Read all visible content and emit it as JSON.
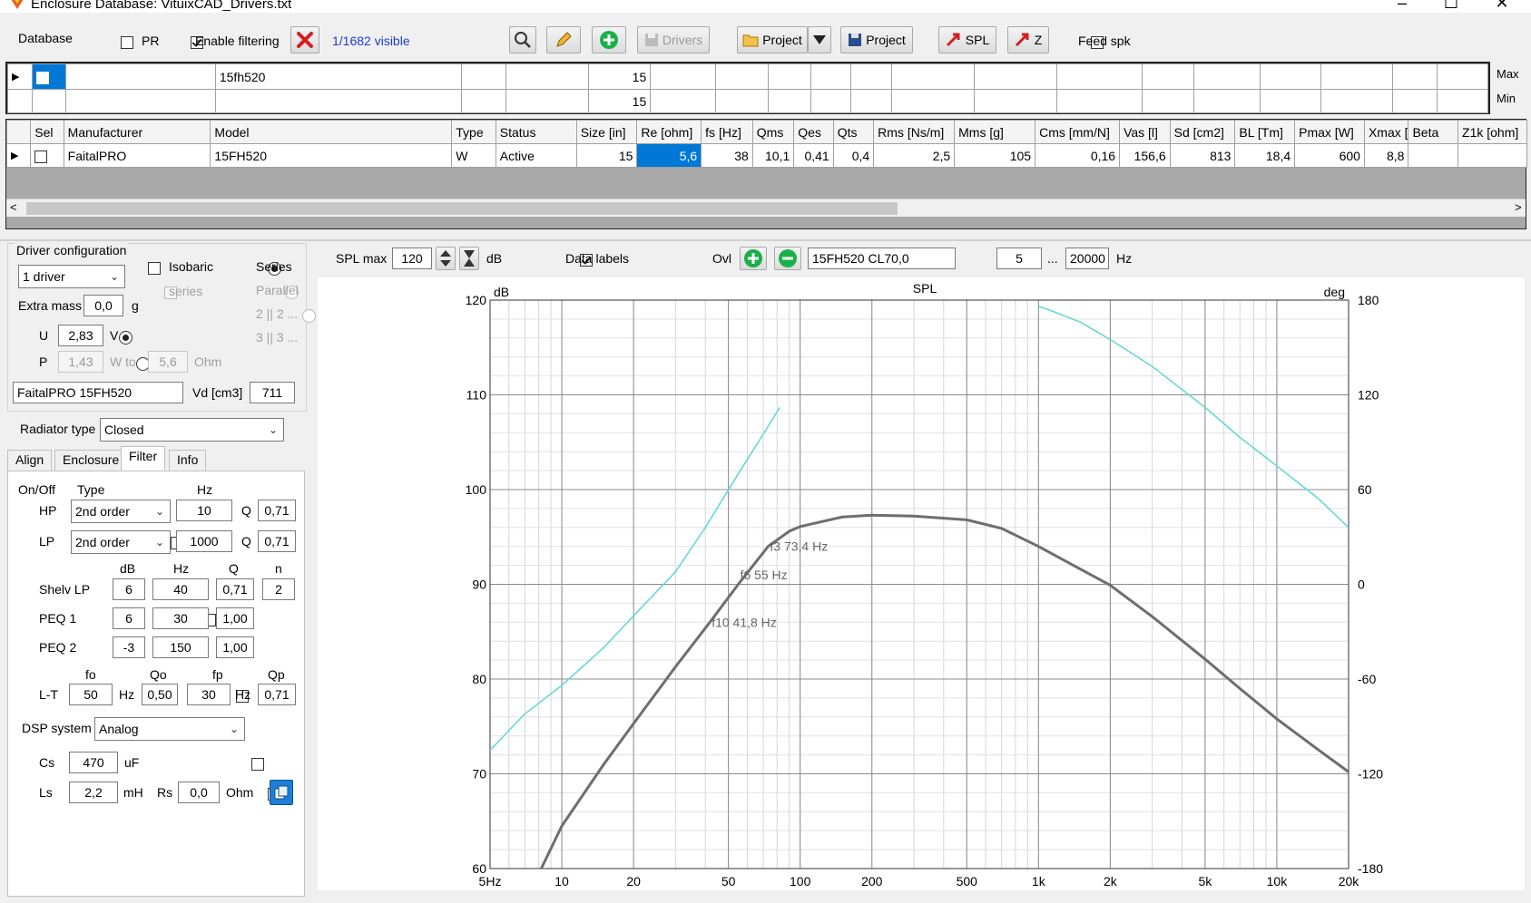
{
  "window": {
    "title": "Enclosure  Database: VituixCAD_Drivers.txt",
    "controls": [
      "–",
      "☐",
      "✕"
    ]
  },
  "toolbar": {
    "database_label": "Database",
    "pr_label": "PR",
    "pr_checked": false,
    "filtering_label": "Enable filtering",
    "filtering_checked": true,
    "visible_count": "1/1682 visible",
    "drivers_label": "Drivers",
    "project_open_label": "Project",
    "project_save_label": "Project",
    "spl_label": "SPL",
    "z_label": "Z",
    "feed_spk_label": "Feed spk",
    "feed_spk_checked": false
  },
  "filter_grid": {
    "model_filter": "15fh520",
    "size_max": "15",
    "size_min": "15",
    "max_label": "Max",
    "min_label": "Min"
  },
  "driver_table": {
    "columns": [
      "Sel",
      "Manufacturer",
      "Model",
      "Type",
      "Status",
      "Size [in]",
      "Re [ohm]",
      "fs [Hz]",
      "Qms",
      "Qes",
      "Qts",
      "Rms [Ns/m]",
      "Mms [g]",
      "Cms [mm/N]",
      "Vas [l]",
      "Sd [cm2]",
      "BL [Tm]",
      "Pmax [W]",
      "Xmax [mm]",
      "Beta",
      "Z1k [ohm]"
    ],
    "rows": [
      {
        "cells": [
          "",
          "FaitalPRO",
          "15FH520",
          "W",
          "Active",
          "15",
          "5,6",
          "38",
          "10,1",
          "0,41",
          "0,4",
          "2,5",
          "105",
          "0,16",
          "156,6",
          "813",
          "18,4",
          "600",
          "8,8",
          "",
          ""
        ]
      }
    ]
  },
  "driver_config": {
    "group_label": "Driver configuration",
    "drivers_select": "1 driver",
    "isobaric_label": "Isobaric",
    "series_sub_label": "series",
    "series_label": "Series",
    "parallel_label": "Parallel",
    "two_label": "2 || 2 ...",
    "three_label": "3 || 3 ...",
    "extra_mass_label": "Extra mass",
    "extra_mass_value": "0,0",
    "extra_mass_unit": "g",
    "u_label": "U",
    "u_value": "2,83",
    "u_unit": "V",
    "p_label": "P",
    "p_value": "1,43",
    "p_unit": "W to",
    "ohm_value": "5,6",
    "ohm_unit": "Ohm",
    "driver_name": "FaitalPRO 15FH520",
    "vd_label": "Vd [cm3]",
    "vd_value": "711",
    "radiator_label": "Radiator type",
    "radiator_value": "Closed"
  },
  "tabs": [
    "Align",
    "Enclosure",
    "Filter",
    "Info"
  ],
  "filter_tab": {
    "onoff_label": "On/Off",
    "type_label": "Type",
    "hz_label": "Hz",
    "hp_label": "HP",
    "hp_type": "2nd order",
    "hp_hz": "10",
    "q_label": "Q",
    "hp_q": "0,71",
    "lp_label": "LP",
    "lp_type": "2nd order",
    "lp_hz": "1000",
    "lp_q": "0,71",
    "db_col": "dB",
    "hz_col": "Hz",
    "q_col": "Q",
    "n_col": "n",
    "shelv_label": "Shelv LP",
    "shelv_db": "6",
    "shelv_hz": "40",
    "shelv_q": "0,71",
    "shelv_n": "2",
    "peq1_label": "PEQ 1",
    "peq1_db": "6",
    "peq1_hz": "30",
    "peq1_q": "1,00",
    "peq2_label": "PEQ 2",
    "peq2_db": "-3",
    "peq2_hz": "150",
    "peq2_q": "1,00",
    "fo_label": "fo",
    "qo_label": "Qo",
    "fp_label": "fp",
    "qp_label": "Qp",
    "lt_label": "L-T",
    "lt_fo": "50",
    "lt_qo": "0,50",
    "lt_fp": "30",
    "lt_qp": "0,71",
    "lt_hz1": "Hz",
    "lt_hz2": "Hz",
    "dsp_label": "DSP system",
    "dsp_value": "Analog",
    "cs_label": "Cs",
    "cs_value": "470",
    "cs_unit": "uF",
    "ls_label": "Ls",
    "ls_value": "2,2",
    "ls_unit": "mH",
    "rs_label": "Rs",
    "rs_value": "0,0",
    "rs_unit": "Ohm"
  },
  "chart_bar": {
    "splmax_label": "SPL max",
    "splmax_checked": true,
    "splmax_value": "120",
    "db_unit": "dB",
    "datalabels_label": "Data labels",
    "datalabels_checked": true,
    "ovl_label": "Ovl",
    "overlay_name": "15FH520 CL70,0",
    "freq_min": "5",
    "dots": "...",
    "freq_max": "20000",
    "hz_unit": "Hz"
  },
  "chart_data": {
    "type": "line",
    "title": "SPL",
    "ylabel_left": "dB",
    "ylabel_right": "deg",
    "x_scale": "log",
    "xlim": [
      5,
      20000
    ],
    "ylim": [
      60,
      120
    ],
    "y2lim": [
      -180,
      180
    ],
    "x_ticks": [
      {
        "v": 5,
        "label": "5Hz"
      },
      {
        "v": 10,
        "label": "10"
      },
      {
        "v": 20,
        "label": "20"
      },
      {
        "v": 50,
        "label": "50"
      },
      {
        "v": 100,
        "label": "100"
      },
      {
        "v": 200,
        "label": "200"
      },
      {
        "v": 500,
        "label": "500"
      },
      {
        "v": 1000,
        "label": "1k"
      },
      {
        "v": 2000,
        "label": "2k"
      },
      {
        "v": 5000,
        "label": "5k"
      },
      {
        "v": 10000,
        "label": "10k"
      },
      {
        "v": 20000,
        "label": "20k"
      }
    ],
    "y_ticks": [
      60,
      70,
      80,
      90,
      100,
      110,
      120
    ],
    "y2_ticks": [
      -180,
      -120,
      -60,
      0,
      60,
      120,
      180
    ],
    "grid": true,
    "series": [
      {
        "axis": "left",
        "color": "#6e6e6e",
        "points": [
          [
            8.2,
            60
          ],
          [
            10,
            64.5
          ],
          [
            15,
            71.0
          ],
          [
            20,
            75.3
          ],
          [
            30,
            81.3
          ],
          [
            41.8,
            86.0
          ],
          [
            55,
            90.0
          ],
          [
            73.4,
            94.0
          ],
          [
            90,
            95.6
          ],
          [
            100,
            96.1
          ],
          [
            150,
            97.1
          ],
          [
            200,
            97.3
          ],
          [
            300,
            97.2
          ],
          [
            500,
            96.8
          ],
          [
            700,
            95.9
          ],
          [
            1000,
            94.0
          ],
          [
            1500,
            91.6
          ],
          [
            2000,
            89.9
          ],
          [
            3000,
            86.6
          ],
          [
            5000,
            82.1
          ],
          [
            7000,
            79.0
          ],
          [
            10000,
            75.8
          ],
          [
            15000,
            72.5
          ],
          [
            20000,
            70.2
          ]
        ]
      },
      {
        "axis": "right",
        "color": "#66d9d6",
        "points": [
          [
            5,
            -105
          ],
          [
            7,
            -82
          ],
          [
            10,
            -64
          ],
          [
            15,
            -40
          ],
          [
            20,
            -20
          ],
          [
            30,
            8
          ],
          [
            40,
            36
          ],
          [
            55,
            70
          ],
          [
            70,
            95
          ],
          [
            82,
            112
          ],
          [
            1000,
            176
          ],
          [
            1100,
            174
          ],
          [
            1500,
            166
          ],
          [
            2000,
            155
          ],
          [
            3000,
            138
          ],
          [
            5000,
            112
          ],
          [
            7000,
            93
          ],
          [
            10000,
            75
          ],
          [
            15000,
            54
          ],
          [
            20000,
            36
          ]
        ]
      }
    ],
    "annotations": [
      {
        "text": "f3 73,4 Hz",
        "x": 73.4,
        "y": 94.0
      },
      {
        "text": "f6 55 Hz",
        "x": 55,
        "y": 91.0
      },
      {
        "text": "f10 41,8 Hz",
        "x": 41.8,
        "y": 86.0
      }
    ]
  }
}
